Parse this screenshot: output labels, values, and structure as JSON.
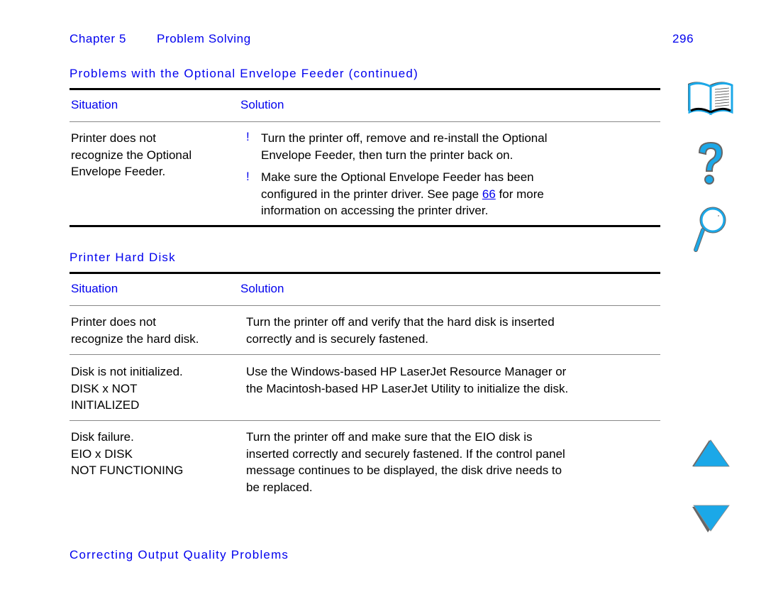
{
  "header": {
    "chapter": "Chapter 5",
    "chapter_title": "Problem Solving",
    "page_number": "296"
  },
  "sections": [
    {
      "title": "Problems with the Optional Envelope Feeder (continued)",
      "columns": [
        "Situation",
        "Solution"
      ],
      "rows": [
        {
          "situation": [
            "Printer does not",
            "recognize the Optional",
            "Envelope Feeder."
          ],
          "bullets": [
            {
              "marker": "!",
              "lines": [
                "Turn the printer off, remove and re-install the Optional",
                "Envelope Feeder, then turn the printer back on."
              ]
            },
            {
              "marker": "!",
              "line1": "Make sure the Optional Envelope Feeder has been",
              "line2_pre": "configured in the printer driver. See page ",
              "link": "66",
              "line2_post": " for more",
              "line3": "information on accessing the printer driver."
            }
          ]
        }
      ]
    },
    {
      "title": "Printer Hard Disk",
      "columns": [
        "Situation",
        "Solution"
      ],
      "rows": [
        {
          "situation": [
            "Printer does not",
            "recognize the hard disk."
          ],
          "solution": [
            "Turn the printer off and verify that the hard disk is inserted",
            "correctly and is securely fastened."
          ]
        },
        {
          "situation": [
            "Disk is not initialized.",
            "DISK x NOT",
            "INITIALIZED"
          ],
          "solution": [
            "Use the Windows-based HP LaserJet Resource Manager or",
            "the Macintosh-based HP LaserJet Utility to initialize the disk."
          ]
        },
        {
          "situation": [
            "Disk failure.",
            "EIO x DISK",
            "NOT FUNCTIONING"
          ],
          "solution": [
            "Turn the printer off and make sure that the EIO disk is",
            "inserted correctly and securely fastened. If the control panel",
            "message continues to be displayed, the disk drive needs to",
            "be replaced."
          ]
        }
      ]
    }
  ],
  "next_section": "Correcting Output Quality Problems",
  "nav_icons": [
    "book-icon",
    "help-question-icon",
    "search-magnifier-icon",
    "previous-page-arrow-icon",
    "next-page-arrow-icon"
  ],
  "colors": {
    "accent_blue": "#0000ee",
    "icon_blue": "#1ba8e8",
    "icon_shadow": "#666666"
  }
}
